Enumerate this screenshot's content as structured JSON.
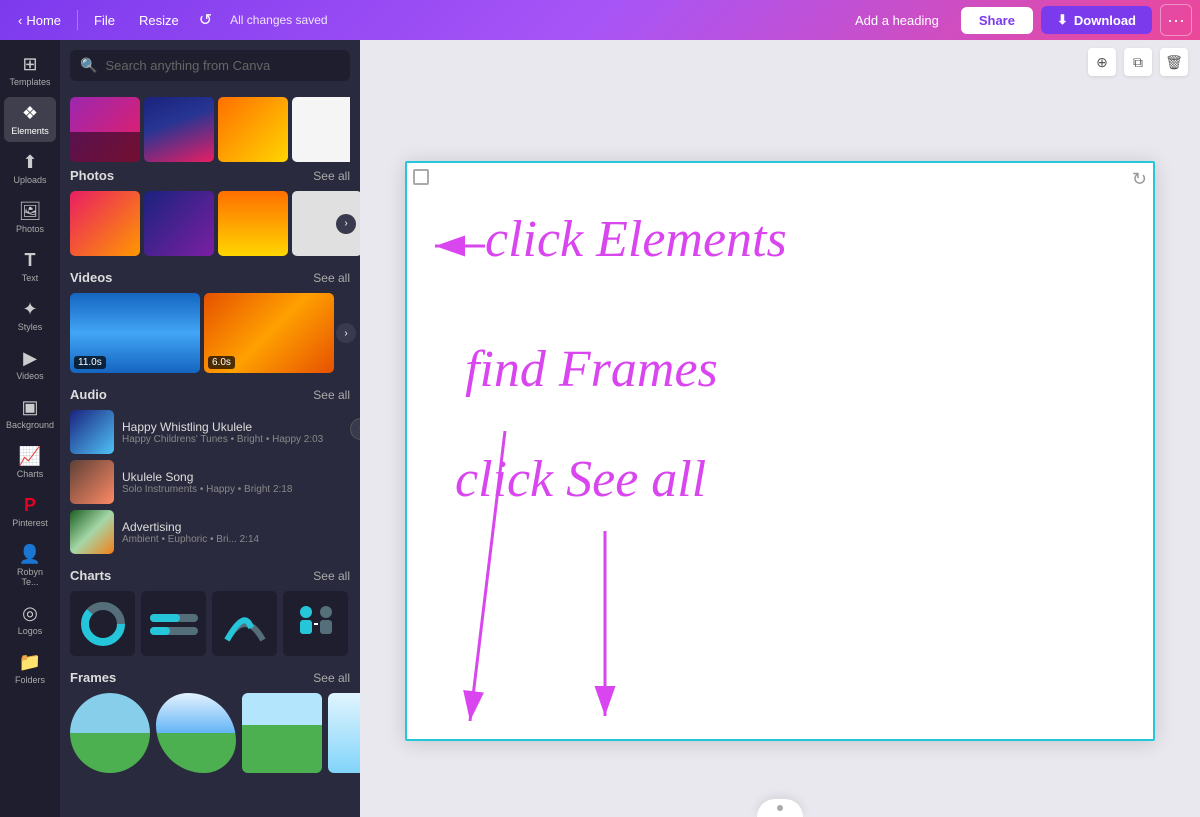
{
  "topbar": {
    "home_label": "Home",
    "file_label": "File",
    "resize_label": "Resize",
    "status": "All changes saved",
    "add_heading_label": "Add a heading",
    "share_label": "Share",
    "download_label": "Download",
    "more_label": "···"
  },
  "sidebar": {
    "items": [
      {
        "id": "templates",
        "label": "Templates",
        "icon": "⊞"
      },
      {
        "id": "elements",
        "label": "Elements",
        "icon": "❖",
        "active": true
      },
      {
        "id": "uploads",
        "label": "Uploads",
        "icon": "↑"
      },
      {
        "id": "photos",
        "label": "Photos",
        "icon": "🖼"
      },
      {
        "id": "text",
        "label": "Text",
        "icon": "T"
      },
      {
        "id": "styles",
        "label": "Styles",
        "icon": "✦"
      },
      {
        "id": "videos",
        "label": "Videos",
        "icon": "▶"
      },
      {
        "id": "background",
        "label": "Background",
        "icon": "▣"
      },
      {
        "id": "charts",
        "label": "Charts",
        "icon": "📈"
      },
      {
        "id": "pinterest",
        "label": "Pinterest",
        "icon": "P"
      },
      {
        "id": "robyn",
        "label": "Robyn Te...",
        "icon": "👤"
      },
      {
        "id": "logos",
        "label": "Logos",
        "icon": "◎"
      },
      {
        "id": "folders",
        "label": "Folders",
        "icon": "📁"
      }
    ]
  },
  "panel": {
    "search_placeholder": "Search anything from Canva",
    "sections": {
      "photos": {
        "title": "Photos",
        "see_all": "See all"
      },
      "videos": {
        "title": "Videos",
        "see_all": "See all",
        "items": [
          {
            "duration": "11.0s"
          },
          {
            "duration": "6.0s"
          }
        ]
      },
      "audio": {
        "title": "Audio",
        "see_all": "See all",
        "items": [
          {
            "title": "Happy Whistling Ukulele",
            "meta": "Happy Childrens' Tunes • Bright • Happy 2:03"
          },
          {
            "title": "Ukulele Song",
            "meta": "Solo Instruments • Happy • Bright 2:18"
          },
          {
            "title": "Advertising",
            "meta": "Ambient • Euphoric • Bri... 2:14"
          }
        ]
      },
      "charts": {
        "title": "Charts",
        "see_all": "See all"
      },
      "frames": {
        "title": "Frames",
        "see_all": "See all"
      }
    }
  },
  "canvas": {
    "annotations": {
      "click_elements": "click Elements",
      "find_frames": "find Frames",
      "click_see_all": "click See all"
    }
  }
}
